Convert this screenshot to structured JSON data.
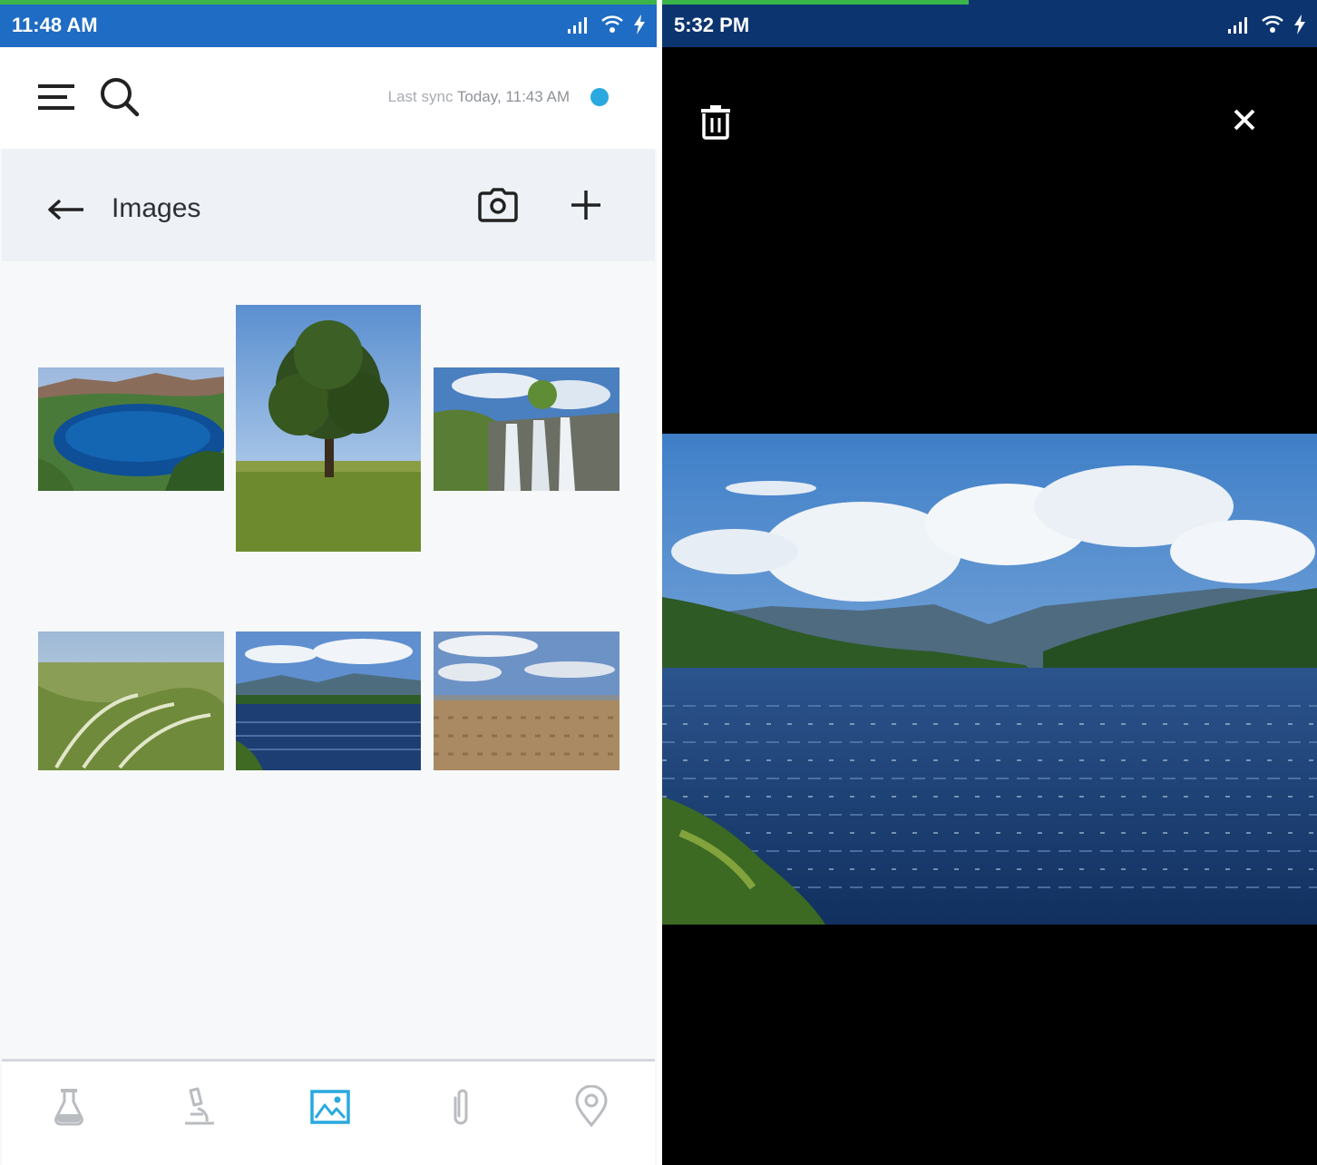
{
  "left": {
    "status_bar": {
      "time": "11:48 AM"
    },
    "app_bar": {
      "sync_label": "Last sync",
      "sync_value": "Today, 11:43 AM",
      "icons": [
        "menu-icon",
        "search-icon",
        "sync-status-dot"
      ]
    },
    "sub_bar": {
      "title": "Images",
      "icons": [
        "back-arrow-icon",
        "camera-icon",
        "plus-icon"
      ]
    },
    "images": [
      {
        "subject": "lake"
      },
      {
        "subject": "tree"
      },
      {
        "subject": "waterfall"
      },
      {
        "subject": "grassland"
      },
      {
        "subject": "river"
      },
      {
        "subject": "desert"
      }
    ],
    "bottom_nav": {
      "items": [
        {
          "icon": "flask-icon",
          "active": false
        },
        {
          "icon": "microscope-icon",
          "active": false
        },
        {
          "icon": "image-icon",
          "active": true
        },
        {
          "icon": "paperclip-icon",
          "active": false
        },
        {
          "icon": "location-pin-icon",
          "active": false
        }
      ],
      "active_color": "#29a9e0",
      "inactive_color": "#b9bcc0"
    }
  },
  "right": {
    "status_bar": {
      "time": "5:32 PM"
    },
    "toolbar": {
      "icons": [
        "trash-icon",
        "close-icon"
      ]
    },
    "photo": {
      "subject": "river"
    }
  },
  "colors": {
    "status_bar_left": "#1f6cc4",
    "status_bar_right": "#0c3570",
    "accent": "#29a9e0"
  }
}
